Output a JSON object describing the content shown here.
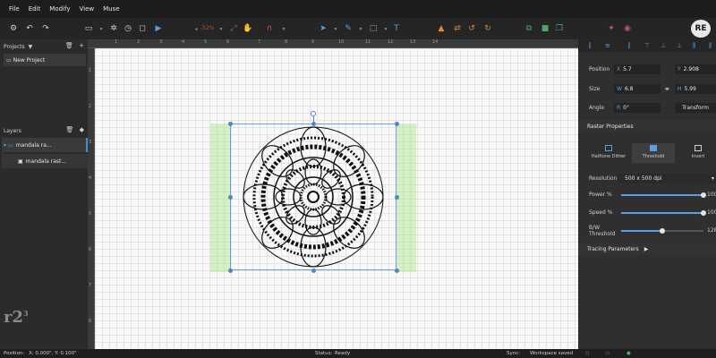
{
  "menu": [
    "File",
    "Edit",
    "Modify",
    "View",
    "Muse"
  ],
  "toolbar": {
    "zoom": "-52%"
  },
  "logo": "RE",
  "projects": {
    "header": "Projects",
    "items": [
      "New Project"
    ]
  },
  "layers": {
    "header": "Layers",
    "items": [
      "mandala ra...",
      "mandala rast..."
    ]
  },
  "ruler": {
    "top": [
      "1",
      "2",
      "3",
      "4",
      "5",
      "6",
      "7",
      "8",
      "9",
      "10",
      "11",
      "12",
      "13",
      "14"
    ],
    "left": [
      "1",
      "2",
      "3",
      "4",
      "5",
      "6",
      "7",
      "8"
    ]
  },
  "watermark": {
    "main": "r2",
    "sup": "3"
  },
  "properties": {
    "position_label": "Position",
    "pos_x_axis": "X",
    "pos_x": "5.7",
    "pos_y_axis": "Y",
    "pos_y": "2.908",
    "size_label": "Size",
    "size_w_axis": "W",
    "size_w": "6.8",
    "size_h_axis": "H",
    "size_h": "5.99",
    "angle_label": "Angle",
    "angle_axis": "R",
    "angle": "0°",
    "transform_button": "Transform"
  },
  "raster": {
    "header": "Raster Properties",
    "modes": [
      {
        "label": "Halftone Dither",
        "active": false
      },
      {
        "label": "Threshold",
        "active": true
      },
      {
        "label": "Invert",
        "active": false
      }
    ],
    "resolution_label": "Resolution",
    "resolution_value": "500 x 500 dpi",
    "power_label": "Power %",
    "power_value": 100,
    "speed_label": "Speed %",
    "speed_value": 100,
    "threshold_label": "B/W Threshold",
    "threshold_value": 128
  },
  "tracing": {
    "header": "Tracing Parameters"
  },
  "status": {
    "position_label": "Position:",
    "position_value": "X: 0.000\", Y: 0.100\"",
    "status_label": "Status:",
    "status_value": "Ready",
    "sync_label": "Sync:",
    "sync_value": "Workspace saved"
  }
}
